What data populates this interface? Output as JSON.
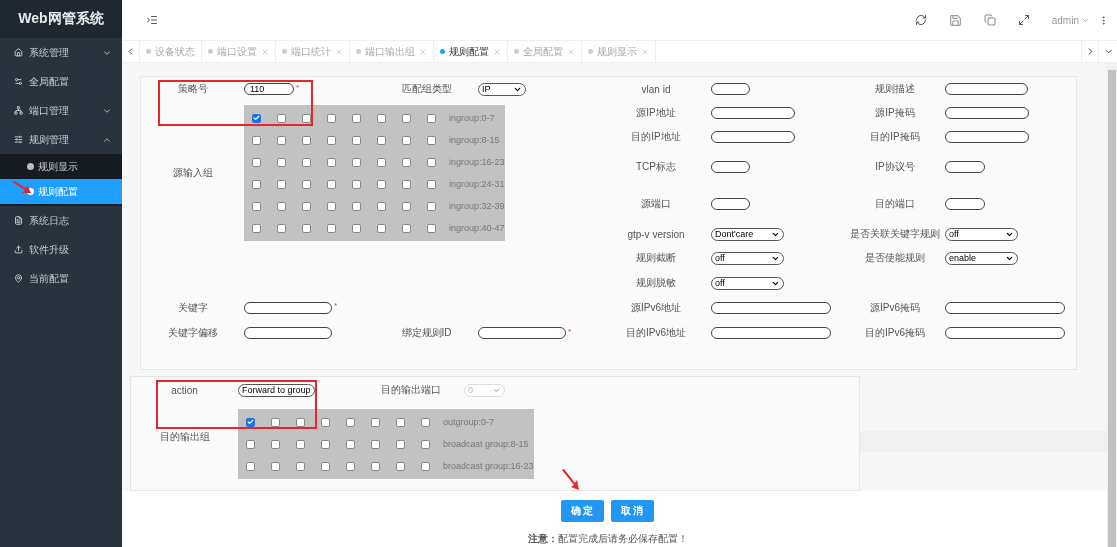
{
  "sidebar": {
    "title": "Web网管系统",
    "items": [
      {
        "label": "系统管理",
        "selected": false,
        "expanded": false
      },
      {
        "label": "全局配置",
        "selected": false
      },
      {
        "label": "端口管理",
        "selected": false,
        "expanded": false
      },
      {
        "label": "规则管理",
        "selected": false,
        "expanded": true,
        "children": [
          {
            "label": "规则显示",
            "selected": false
          },
          {
            "label": "规则配置",
            "selected": true
          }
        ]
      },
      {
        "label": "系统日志",
        "selected": false
      },
      {
        "label": "软件升级",
        "selected": false
      },
      {
        "label": "当前配置",
        "selected": false
      }
    ]
  },
  "header": {
    "user": "admin"
  },
  "tabs": [
    {
      "label": "设备状态",
      "selected": false,
      "closable": false
    },
    {
      "label": "端口设置",
      "selected": false,
      "closable": true
    },
    {
      "label": "端口统计",
      "selected": false,
      "closable": true
    },
    {
      "label": "端口输出组",
      "selected": false,
      "closable": true
    },
    {
      "label": "规则配置",
      "selected": true,
      "closable": true
    },
    {
      "label": "全局配置",
      "selected": false,
      "closable": true
    },
    {
      "label": "规则显示",
      "selected": false,
      "closable": true
    }
  ],
  "rule_form": {
    "policy": {
      "label": "策略号",
      "value": "110",
      "mark": "*"
    },
    "match_type": {
      "label": "匹配组类型",
      "value": "IP"
    },
    "ingroup": {
      "label": "源输入组",
      "rows": [
        {
          "label": "ingroup:0-7",
          "checks": [
            true,
            false,
            false,
            false,
            false,
            false,
            false,
            false
          ]
        },
        {
          "label": "ingroup:8-15",
          "checks": [
            false,
            false,
            false,
            false,
            false,
            false,
            false,
            false
          ]
        },
        {
          "label": "ingroup:16-23",
          "checks": [
            false,
            false,
            false,
            false,
            false,
            false,
            false,
            false
          ]
        },
        {
          "label": "ingroup:24-31",
          "checks": [
            false,
            false,
            false,
            false,
            false,
            false,
            false,
            false
          ]
        },
        {
          "label": "ingroup:32-39",
          "checks": [
            false,
            false,
            false,
            false,
            false,
            false,
            false,
            false
          ]
        },
        {
          "label": "ingroup:40-47",
          "checks": [
            false,
            false,
            false,
            false,
            false,
            false,
            false,
            false
          ]
        }
      ]
    },
    "fields": [
      {
        "label": "vlan id",
        "kind": "input"
      },
      {
        "label": "规则描述",
        "kind": "input"
      },
      {
        "label": "源IP地址",
        "kind": "input"
      },
      {
        "label": "源IP掩码",
        "kind": "input"
      },
      {
        "label": "目的IP地址",
        "kind": "input"
      },
      {
        "label": "目的IP掩码",
        "kind": "input"
      },
      {
        "label": "TCP标志",
        "kind": "input"
      },
      {
        "label": "IP协议号",
        "kind": "input"
      },
      {
        "label": "源端口",
        "kind": "input"
      },
      {
        "label": "目的端口",
        "kind": "input"
      },
      {
        "label": "gtp-v version",
        "kind": "select",
        "value": "Dont'care"
      },
      {
        "label": "是否关联关键字规则",
        "kind": "select",
        "value": "off"
      },
      {
        "label": "规则截断",
        "kind": "select",
        "value": "off"
      },
      {
        "label": "是否使能规则",
        "kind": "select",
        "value": "enable"
      },
      {
        "label": "规则脱敏",
        "kind": "select",
        "value": "off"
      }
    ],
    "lower_rows": [
      [
        {
          "label": "关键字",
          "mark": "*"
        },
        null,
        {
          "label": "源IPv6地址"
        },
        {
          "label": "源IPv6掩码"
        }
      ],
      [
        {
          "label": "关键字偏移"
        },
        {
          "label": "绑定规则ID",
          "mark": "*"
        },
        {
          "label": "目的IPv6地址"
        },
        {
          "label": "目的IPv6掩码"
        }
      ]
    ]
  },
  "action_form": {
    "action": {
      "label": "action",
      "value": "Forward to group"
    },
    "out_port": {
      "label": "目的输出端口",
      "value": "0",
      "disabled": true
    },
    "outgroup": {
      "label": "目的输出组",
      "rows": [
        {
          "label": "outgroup:0-7",
          "checks": [
            true,
            false,
            false,
            false,
            false,
            false,
            false,
            false
          ]
        },
        {
          "label": "broadcast group:8-15",
          "checks": [
            false,
            false,
            false,
            false,
            false,
            false,
            false,
            false
          ]
        },
        {
          "label": "broadcast group:16-23",
          "checks": [
            false,
            false,
            false,
            false,
            false,
            false,
            false,
            false
          ]
        }
      ]
    }
  },
  "buttons": [
    {
      "label": "确定"
    },
    {
      "label": "取消"
    }
  ],
  "note": "**注意：**配置完成后请务必保存配置！"
}
